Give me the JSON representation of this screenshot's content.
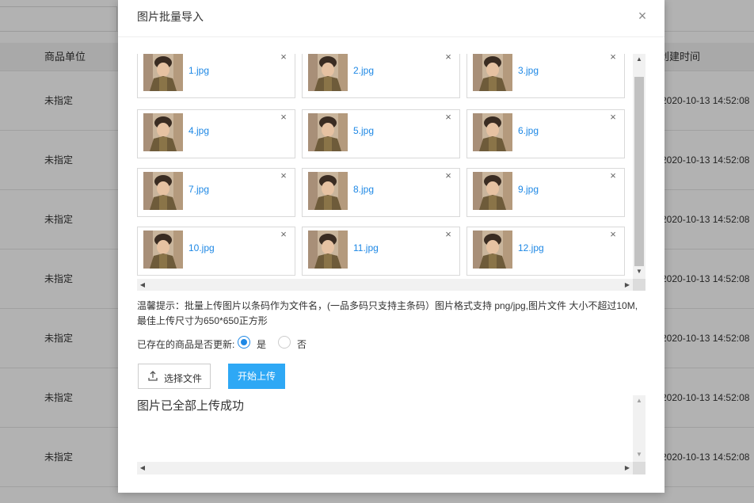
{
  "background": {
    "columns": {
      "unit": "商品单位",
      "created": "创建时间"
    },
    "rows": [
      {
        "unit": "未指定",
        "created": "2020-10-13 14:52:08"
      },
      {
        "unit": "未指定",
        "created": "2020-10-13 14:52:08"
      },
      {
        "unit": "未指定",
        "created": "2020-10-13 14:52:08"
      },
      {
        "unit": "未指定",
        "created": "2020-10-13 14:52:08"
      },
      {
        "unit": "未指定",
        "created": "2020-10-13 14:52:08"
      },
      {
        "unit": "未指定",
        "created": "2020-10-13 14:52:08"
      },
      {
        "unit": "未指定",
        "created": "2020-10-13 14:52:08"
      }
    ]
  },
  "modal": {
    "title": "图片批量导入",
    "close_icon": "×",
    "files": [
      {
        "name": "1.jpg"
      },
      {
        "name": "2.jpg"
      },
      {
        "name": "3.jpg"
      },
      {
        "name": "4.jpg"
      },
      {
        "name": "5.jpg"
      },
      {
        "name": "6.jpg"
      },
      {
        "name": "7.jpg"
      },
      {
        "name": "8.jpg"
      },
      {
        "name": "9.jpg"
      },
      {
        "name": "10.jpg"
      },
      {
        "name": "11.jpg"
      },
      {
        "name": "12.jpg"
      }
    ],
    "remove_icon": "×",
    "tip_line1": "温馨提示：批量上传图片以条码作为文件名，(一品多码只支持主条码）图片格式支持 png/jpg,图片文件 大小不超过10M,",
    "tip_line2": "最佳上传尺寸为650*650正方形",
    "update_label": "已存在的商品是否更新:",
    "update_options": [
      {
        "label": "是",
        "checked": true
      },
      {
        "label": "否",
        "checked": false
      }
    ],
    "choose_button": "选择文件",
    "start_button": "开始上传",
    "result_text": "图片已全部上传成功"
  },
  "colors": {
    "accent": "#1e88e5",
    "start_button_bg": "#2ea8f5",
    "overlay": "rgba(0,0,0,0.30)"
  },
  "icons": {
    "close": "close-icon",
    "remove": "remove-icon",
    "upload": "upload-icon",
    "scroll_up": "▲",
    "scroll_down": "▼",
    "scroll_left": "◀",
    "scroll_right": "▶"
  }
}
